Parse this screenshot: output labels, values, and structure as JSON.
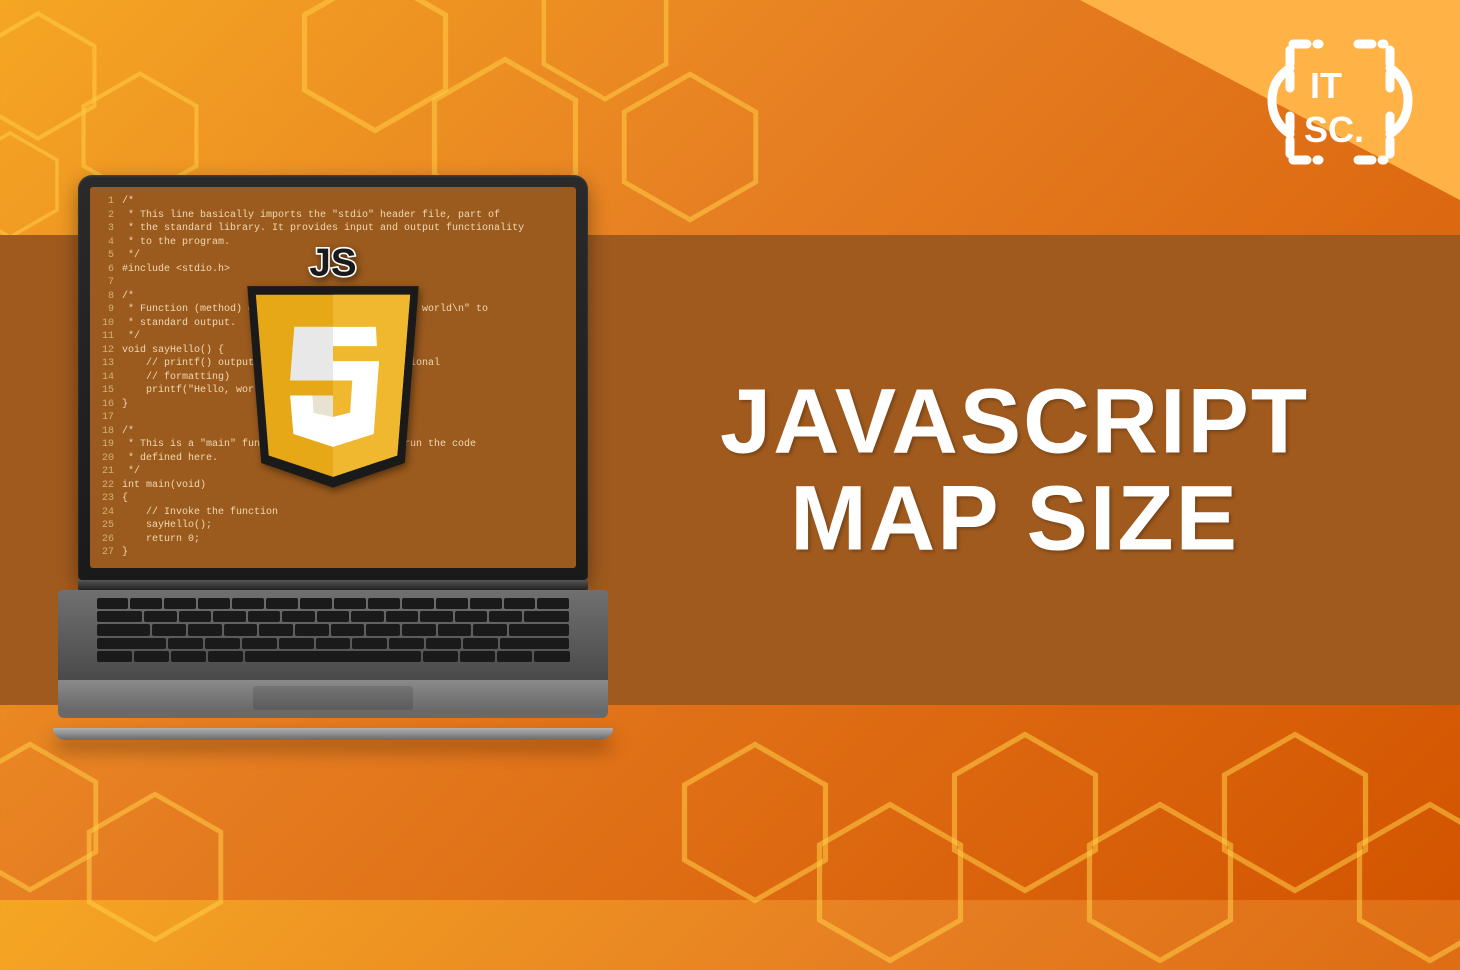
{
  "brand": {
    "logo_label": "ITSC"
  },
  "title": {
    "line1": "JAVASCRIPT",
    "line2": "MAP SIZE"
  },
  "js_badge": {
    "label": "JS",
    "inner_letter": "S"
  },
  "code": {
    "lines": [
      {
        "n": "1",
        "t": "/*"
      },
      {
        "n": "2",
        "t": " * This line basically imports the \"stdio\" header file, part of"
      },
      {
        "n": "3",
        "t": " * the standard library. It provides input and output functionality"
      },
      {
        "n": "4",
        "t": " * to the program."
      },
      {
        "n": "5",
        "t": " */"
      },
      {
        "n": "6",
        "t": "#include <stdio.h>"
      },
      {
        "n": "7",
        "t": ""
      },
      {
        "n": "8",
        "t": "/*"
      },
      {
        "n": "9",
        "t": " * Function (method) declaration. Outputs \"Hello, world\\n\" to"
      },
      {
        "n": "10",
        "t": " * standard output."
      },
      {
        "n": "11",
        "t": " */"
      },
      {
        "n": "12",
        "t": "void sayHello() {"
      },
      {
        "n": "13",
        "t": "    // printf() outputs formatted text (with optional"
      },
      {
        "n": "14",
        "t": "    // formatting)"
      },
      {
        "n": "15",
        "t": "    printf(\"Hello, world\\n\");"
      },
      {
        "n": "16",
        "t": "}"
      },
      {
        "n": "17",
        "t": ""
      },
      {
        "n": "18",
        "t": "/*"
      },
      {
        "n": "19",
        "t": " * This is a \"main\" function. The program will run the code"
      },
      {
        "n": "20",
        "t": " * defined here."
      },
      {
        "n": "21",
        "t": " */"
      },
      {
        "n": "22",
        "t": "int main(void)"
      },
      {
        "n": "23",
        "t": "{"
      },
      {
        "n": "24",
        "t": "    // Invoke the function"
      },
      {
        "n": "25",
        "t": "    sayHello();"
      },
      {
        "n": "26",
        "t": "    return 0;"
      },
      {
        "n": "27",
        "t": "}"
      }
    ]
  },
  "colors": {
    "bg_start": "#f5a623",
    "bg_end": "#d35400",
    "band": "#a05a1e",
    "badge_yellow": "#e6a817",
    "white": "#ffffff",
    "dark": "#1a1a1a"
  }
}
